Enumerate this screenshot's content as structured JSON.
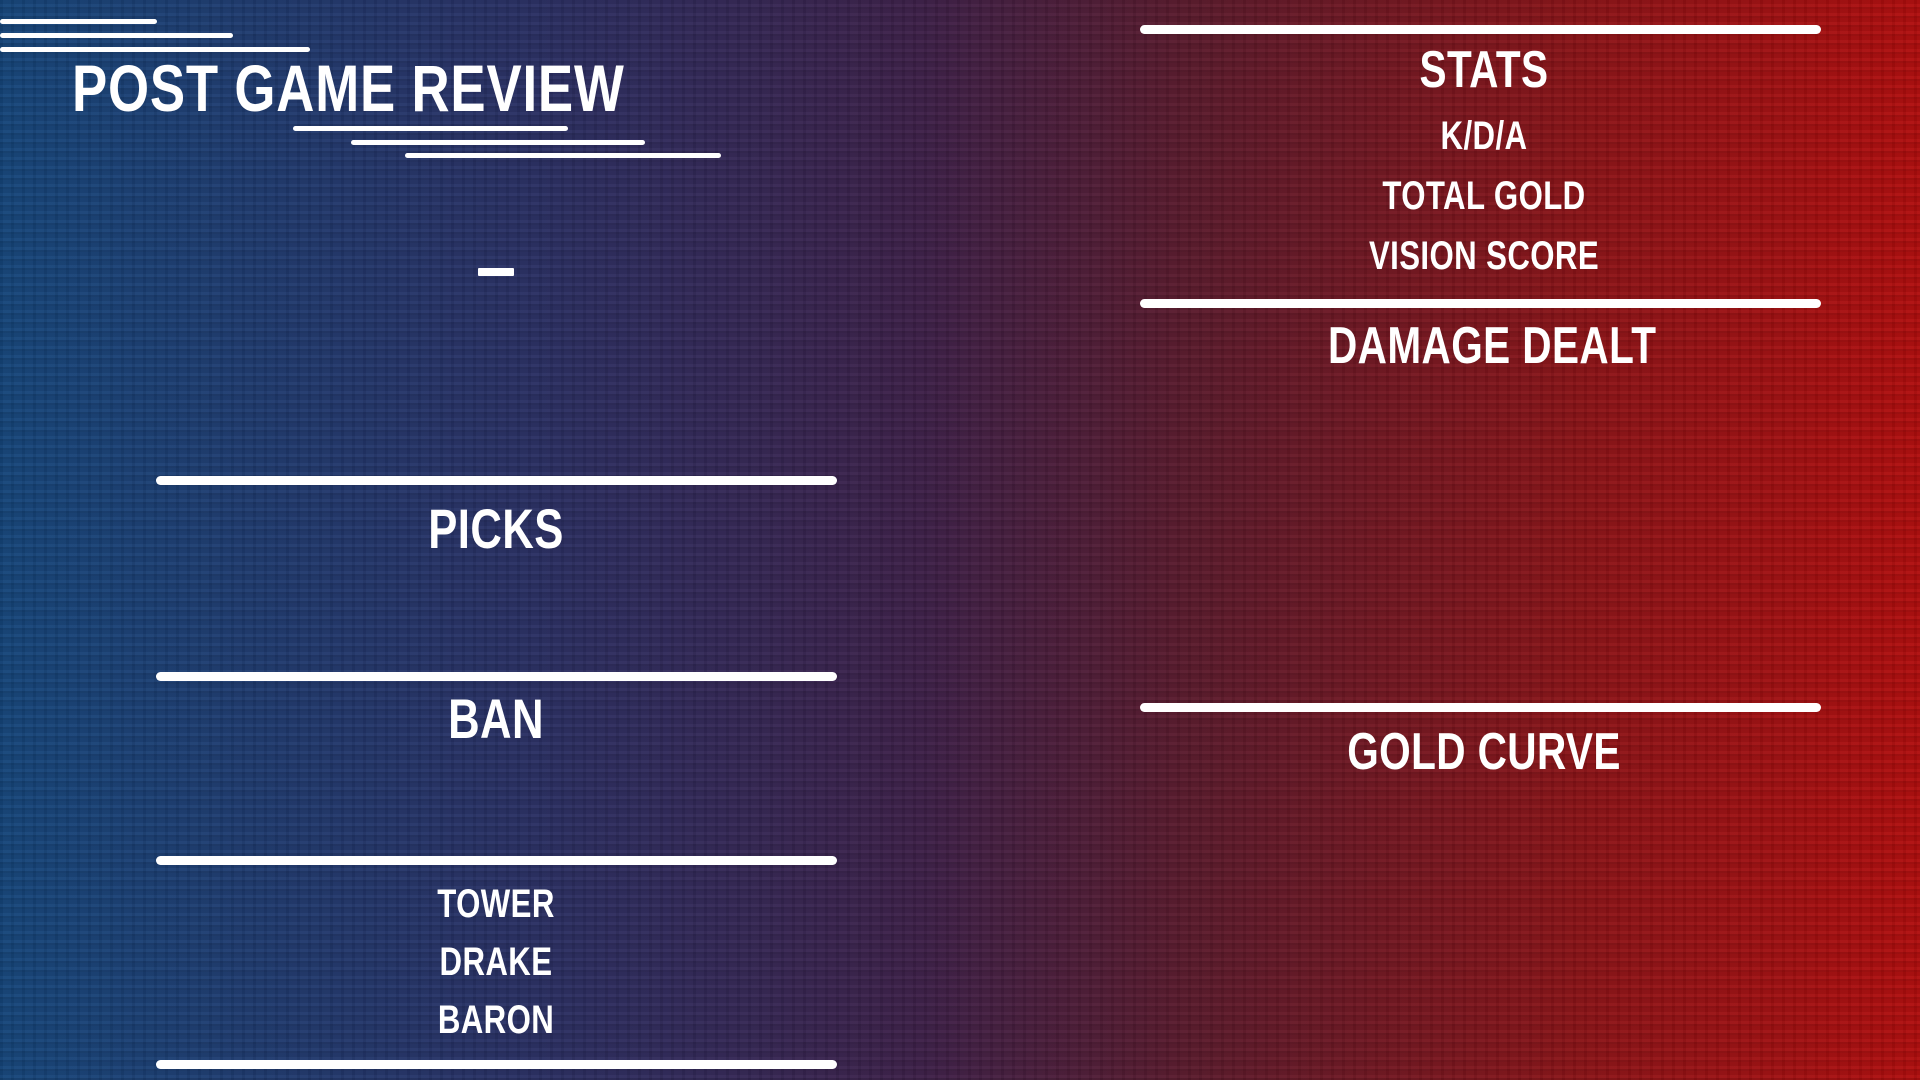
{
  "header": {
    "title": "POST GAME REVIEW"
  },
  "score": {
    "separator": "-"
  },
  "left_panel": {
    "picks_label": "PICKS",
    "ban_label": "BAN",
    "objectives": [
      "TOWER",
      "DRAKE",
      "BARON"
    ]
  },
  "right_panel": {
    "stats_label": "STATS",
    "stats_items": [
      "K/D/A",
      "TOTAL GOLD",
      "VISION SCORE"
    ],
    "damage_label": "DAMAGE DEALT",
    "gold_curve_label": "GOLD CURVE"
  },
  "colors": {
    "blue_side": "#15457a",
    "red_side": "#b00d0d",
    "accent": "#ffffff"
  }
}
